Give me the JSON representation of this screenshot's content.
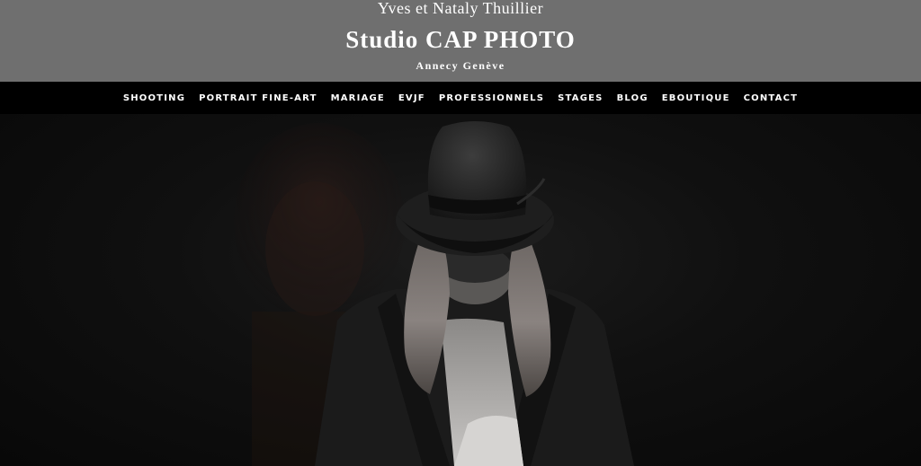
{
  "header": {
    "owners": "Yves et Nataly Thuillier",
    "studio_name": "Studio CAP PHOTO",
    "city": "Annecy Genève"
  },
  "nav": {
    "items": [
      {
        "label": "SHOOTING"
      },
      {
        "label": "PORTRAIT FINE-ART"
      },
      {
        "label": "MARIAGE"
      },
      {
        "label": "EVJF"
      },
      {
        "label": "PROFESSIONNELS"
      },
      {
        "label": "STAGES"
      },
      {
        "label": "BLOG"
      },
      {
        "label": "EBOUTIQUE"
      },
      {
        "label": "CONTACT"
      }
    ]
  },
  "hero": {
    "image": "portrait-woman-hat-black-white-photo"
  },
  "colors": {
    "header_bg": "#6f6f6f",
    "nav_bg": "#000000",
    "page_bg": "#0b0b0b",
    "text": "#ffffff"
  }
}
